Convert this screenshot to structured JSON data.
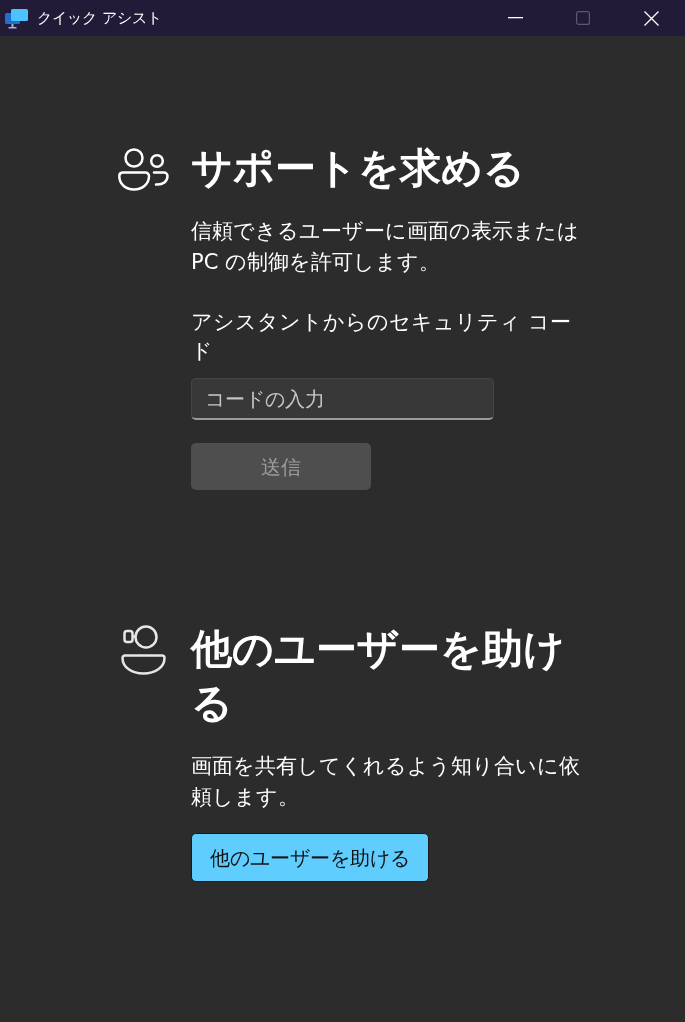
{
  "window": {
    "title": "クイック アシスト",
    "maximize_disabled": true
  },
  "get_help": {
    "heading": "サポートを求める",
    "description": "信頼できるユーザーに画面の表示または PC の制御を許可します。",
    "code_label": "アシスタントからのセキュリティ コード",
    "code_field": {
      "placeholder": "コードの入力"
    },
    "submit": {
      "label": "送信",
      "disabled": true
    }
  },
  "give_help": {
    "heading": "他のユーザーを助ける",
    "description": "画面を共有してくれるよう知り合いに依頼します。",
    "button": {
      "label": "他のユーザーを助ける",
      "disabled": false
    }
  }
}
